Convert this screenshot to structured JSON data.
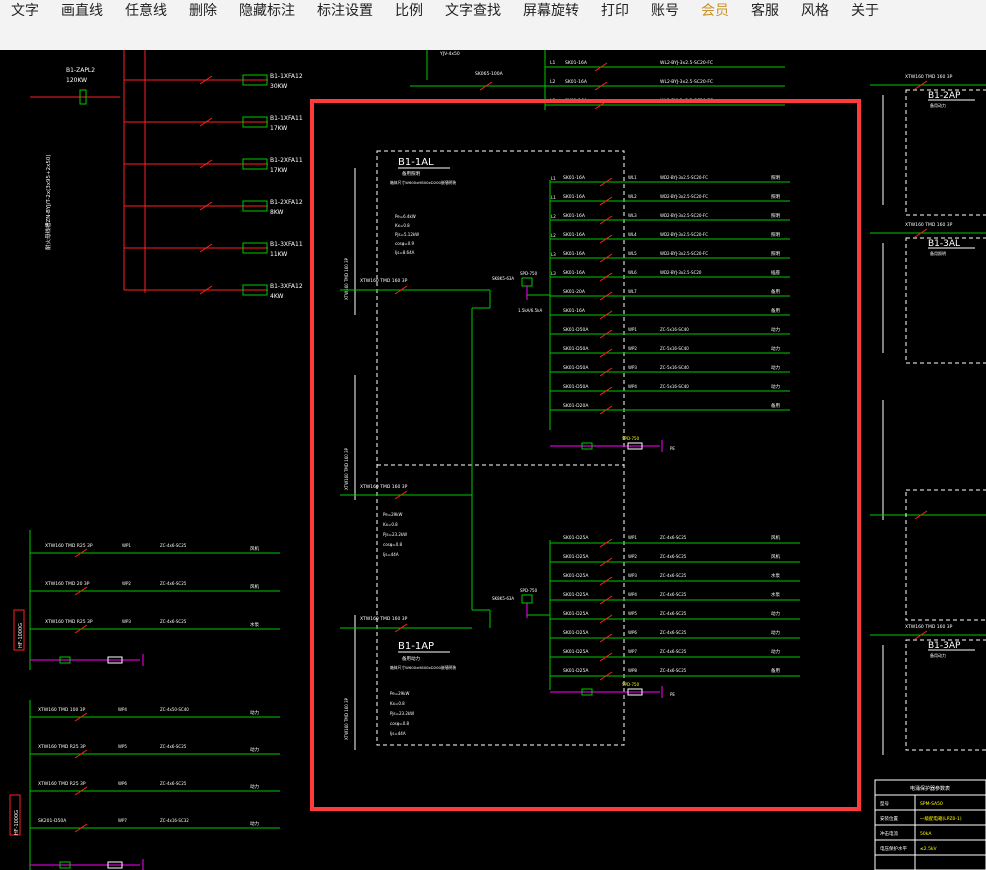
{
  "toolbar": {
    "items": [
      "文字",
      "画直线",
      "任意线",
      "删除",
      "隐藏标注",
      "标注设置",
      "比例",
      "文字查找",
      "屏幕旋转",
      "打印",
      "账号",
      "会员",
      "客服",
      "风格",
      "关于"
    ]
  },
  "colors": {
    "background": "#000000",
    "menubar": "#f3f3f3",
    "wire_green": "#00c800",
    "wire_red": "#ff2020",
    "text_white": "#ffffff",
    "text_yellow": "#ffff00",
    "highlight_box": "#ff3b3b",
    "magenta": "#ff00ff"
  },
  "drawing": {
    "top_left": {
      "panel": "B1-ZAPL2",
      "power": "120KW",
      "cable_note": "耐火母线槽ZN-BYJ/T-2x(3x95+2x50)",
      "circuits": [
        {
          "name": "B1-1XFA12",
          "load": "30KW"
        },
        {
          "name": "B1-1XFA11",
          "load": "17KW"
        },
        {
          "name": "B1-2XFA11",
          "load": "17KW"
        },
        {
          "name": "B1-2XFA12",
          "load": "8KW"
        },
        {
          "name": "B1-3XFA11",
          "load": "11KW"
        },
        {
          "name": "B1-3XFA12",
          "load": "4KW"
        }
      ]
    },
    "top_center": {
      "breaker": "SK065-100A",
      "cable": "YJV-4x50",
      "rows": [
        {
          "phase": "L1",
          "breaker": "SK01-16A",
          "cable": "WL2-BYJ-3x2.5-SC20-FC"
        },
        {
          "phase": "L2",
          "breaker": "SK01-16A",
          "cable": "WL2-BYJ-3x2.5-SC20-FC"
        },
        {
          "phase": "L3",
          "breaker": "SK01-16A",
          "cable": "WL2-BYJ-3x2.5-SC20-FC"
        }
      ]
    },
    "main_al": {
      "title": "B1-1AL",
      "subtitle": "备用照明",
      "note": "箱体尺寸W600xH800xD200嵌墙明装",
      "params": [
        "Pe=6.4kW",
        "Kx=0.8",
        "Pjs=5.12kW",
        "cosφ=0.9",
        "Ijs=8.64A"
      ],
      "incoming": "XTW160 TMD 160 3P",
      "meter_breaker": "SK8K5-63A",
      "spd": "SPD-750",
      "spd_note": "1.5kA/6.5kA",
      "outgoing": [
        {
          "phase": "L1",
          "breaker": "SK01-16A",
          "circuit": "WL1",
          "cable": "WD2-BYJ-3x2.5-SC20-FC",
          "use": "照明"
        },
        {
          "phase": "L1",
          "breaker": "SK01-16A",
          "circuit": "WL2",
          "cable": "WD2-BYJ-3x2.5-SC20-FC",
          "use": "照明"
        },
        {
          "phase": "L2",
          "breaker": "SK01-16A",
          "circuit": "WL3",
          "cable": "WD2-BYJ-3x2.5-SC20-FC",
          "use": "照明"
        },
        {
          "phase": "L2",
          "breaker": "SK01-16A",
          "circuit": "WL4",
          "cable": "WD2-BYJ-3x2.5-SC20-FC",
          "use": "照明"
        },
        {
          "phase": "L3",
          "breaker": "SK01-16A",
          "circuit": "WL5",
          "cable": "WD2-BYJ-3x2.5-SC20-FC",
          "use": "照明"
        },
        {
          "phase": "L3",
          "breaker": "SK01-16A",
          "circuit": "WL6",
          "cable": "WD2-BYJ-3x2.5-SC20",
          "use": "插座"
        },
        {
          "phase": "",
          "breaker": "SK01-20A",
          "circuit": "WL7",
          "cable": "",
          "use": "备用"
        },
        {
          "phase": "",
          "breaker": "SK01-16A",
          "circuit": "",
          "cable": "",
          "use": "备用"
        },
        {
          "phase": "",
          "breaker": "SK01-D50A",
          "circuit": "WP1",
          "cable": "ZC-5x16-SC40",
          "use": "动力"
        },
        {
          "phase": "",
          "breaker": "SK01-D50A",
          "circuit": "WP2",
          "cable": "ZC-5x16-SC40",
          "use": "动力"
        },
        {
          "phase": "",
          "breaker": "SK01-D50A",
          "circuit": "WP3",
          "cable": "ZC-5x16-SC40",
          "use": "动力"
        },
        {
          "phase": "",
          "breaker": "SK01-D50A",
          "circuit": "WP4",
          "cable": "ZC-5x16-SC40",
          "use": "动力"
        },
        {
          "phase": "",
          "breaker": "SK01-D20A",
          "circuit": "",
          "cable": "",
          "use": "备用"
        }
      ],
      "ground": "PE"
    },
    "main_ap": {
      "title": "B1-1AP",
      "subtitle": "备用动力",
      "note": "箱体尺寸W600xH800xD200嵌墙明装",
      "params": [
        "Pe=29kW",
        "Kx=0.8",
        "Pjs=23.2kW",
        "cosφ=0.8",
        "Ijs=44A"
      ],
      "incoming": "XTW160 TMD 160 3P",
      "tie": "XTW160 TMD 160 3P",
      "meter_breaker": "SK8K5-63A",
      "spd": "SPD-750",
      "outgoing": [
        {
          "breaker": "SK01-D25A",
          "circuit": "WP1",
          "cable": "ZC-4x6-SC25",
          "use": "风机"
        },
        {
          "breaker": "SK01-D25A",
          "circuit": "WP2",
          "cable": "ZC-4x6-SC25",
          "use": "风机"
        },
        {
          "breaker": "SK01-D25A",
          "circuit": "WP3",
          "cable": "ZC-4x6-SC25",
          "use": "水泵"
        },
        {
          "breaker": "SK01-D25A",
          "circuit": "WP4",
          "cable": "ZC-4x6-SC25",
          "use": "水泵"
        },
        {
          "breaker": "SK01-D25A",
          "circuit": "WP5",
          "cable": "ZC-4x6-SC25",
          "use": "动力"
        },
        {
          "breaker": "SK01-D25A",
          "circuit": "WP6",
          "cable": "ZC-4x6-SC25",
          "use": "动力"
        },
        {
          "breaker": "SK01-D25A",
          "circuit": "WP7",
          "cable": "ZC-4x6-SC25",
          "use": "动力"
        },
        {
          "breaker": "SK01-D25A",
          "circuit": "WP8",
          "cable": "ZC-4x6-SC25",
          "use": "备用"
        }
      ],
      "ground": "PE"
    },
    "left_lower": {
      "groups": [
        {
          "rows": [
            {
              "breaker": "XTW160 TMD R25 3P",
              "circuit": "WP1",
              "cable": "ZC-4x6-SC25",
              "use": "风机"
            },
            {
              "breaker": "XTW160 TMD 20 3P",
              "circuit": "WP2",
              "cable": "ZC-4x6-SC25",
              "use": "风机"
            },
            {
              "breaker": "XTW160 TMD R25 3P",
              "circuit": "WP3",
              "cable": "ZC-4x6-SC25",
              "use": "水泵"
            }
          ],
          "side_label": "HF-1000G"
        },
        {
          "rows": [
            {
              "breaker": "XTW160 TMD 100 3P",
              "circuit": "WP4",
              "cable": "ZC-4x50-SC40",
              "use": "动力"
            },
            {
              "breaker": "XTW160 TMD R25 3P",
              "circuit": "WP5",
              "cable": "ZC-4x6-SC25",
              "use": "动力"
            },
            {
              "breaker": "XTW160 TMD R25 3P",
              "circuit": "WP6",
              "cable": "ZC-4x6-SC25",
              "use": "动力"
            },
            {
              "breaker": "SK201-D50A",
              "circuit": "WP7",
              "cable": "ZC-4x16-SC32",
              "use": "动力"
            }
          ],
          "side_label": "HF-1000G"
        }
      ]
    },
    "right_column": {
      "panels": [
        {
          "title": "B1-2AP",
          "subtitle": "备用动力",
          "incoming": "XTW160 TMD 160 3P"
        },
        {
          "title": "B1-3AL",
          "subtitle": "备用照明",
          "incoming": "XTW160 TMD 160 3P"
        },
        {
          "title": "B1-3AP",
          "subtitle": "备用动力",
          "incoming": "XTW160 TMD 160 3P"
        }
      ],
      "table": {
        "title": "电涌保护器参数表",
        "rows": [
          [
            "型号",
            "SPM-SA50"
          ],
          [
            "安装位置",
            "一级配电箱(LPZ0-1)"
          ],
          [
            "冲击电流",
            "50kA"
          ],
          [
            "电压保护水平",
            "≤2.5kV"
          ]
        ]
      }
    }
  }
}
